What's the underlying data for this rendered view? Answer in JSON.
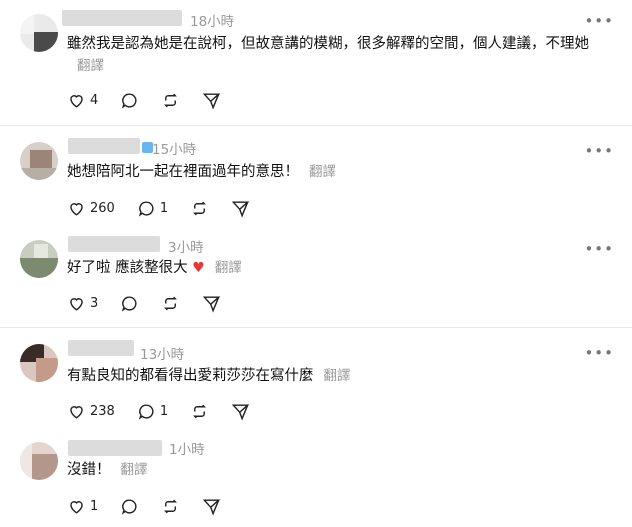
{
  "posts": [
    {
      "time": "18小時",
      "text": "雖然我是認為她是在說柯，但故意講的模糊，很多解釋的空間，個人建議，不理她",
      "translate": "翻譯",
      "likes": "4",
      "replies": ""
    },
    {
      "time": "15小時",
      "text": "她想陪阿北一起在裡面過年的意思！",
      "translate": "翻譯",
      "likes": "260",
      "replies": "1"
    },
    {
      "time": "3小時",
      "text": "好了啦 應該整很大",
      "translate": "翻譯",
      "likes": "3",
      "replies": ""
    },
    {
      "time": "13小時",
      "text": "有點良知的都看得出愛莉莎莎在寫什麼",
      "translate": "翻譯",
      "likes": "238",
      "replies": "1"
    },
    {
      "time": "1小時",
      "text": "沒錯！",
      "translate": "翻譯",
      "likes": "1",
      "replies": ""
    }
  ],
  "icons": {
    "like": "heart-icon",
    "reply": "comment-icon",
    "repost": "repost-icon",
    "share": "share-icon",
    "more": "more-icon",
    "emoji": "red-heart-emoji"
  },
  "colors": {
    "muted": "#999999",
    "heart_emoji": "#e53935",
    "badge": "#6ab5f0"
  }
}
